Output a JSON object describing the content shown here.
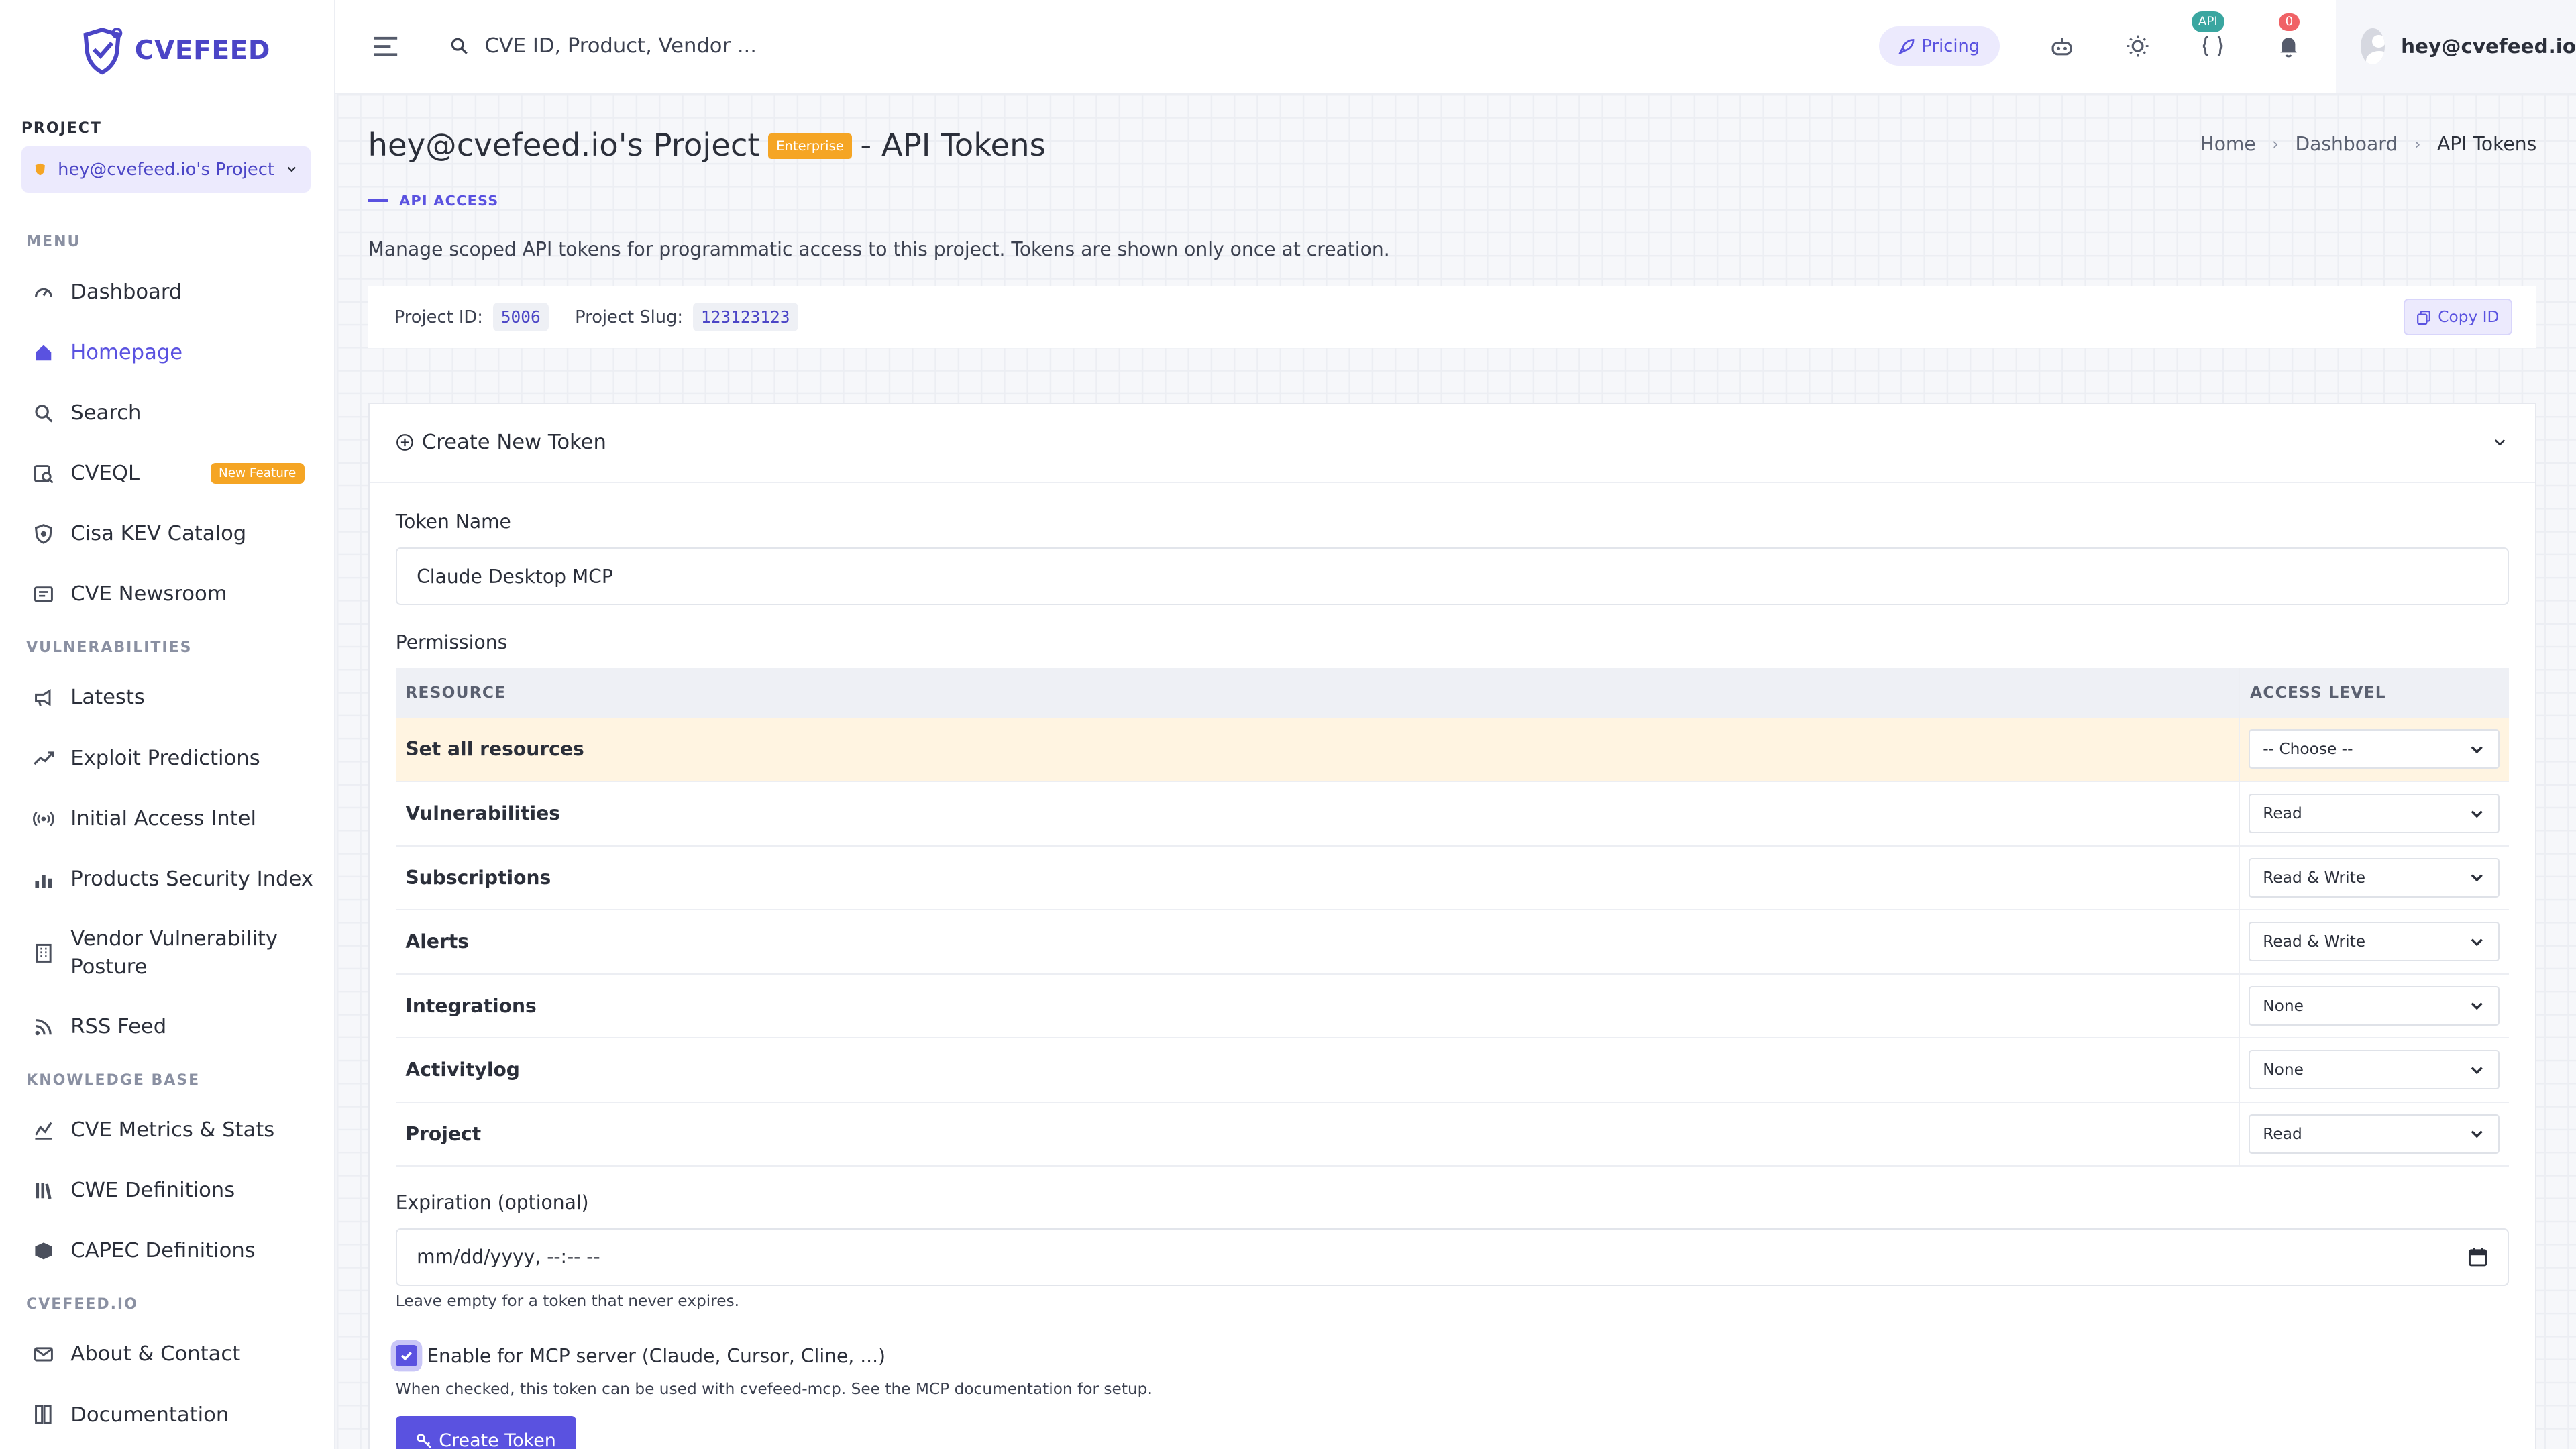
{
  "brand": {
    "name": "CVEFEED",
    "color": "#4b45c6"
  },
  "sidebar": {
    "project_label": "PROJECT",
    "project_name": "hey@cvefeed.io's Project",
    "menu_label": "MENU",
    "menu": [
      {
        "label": "Dashboard",
        "icon": "gauge-icon"
      },
      {
        "label": "Homepage",
        "icon": "home-icon",
        "active": true
      },
      {
        "label": "Search",
        "icon": "search-icon"
      },
      {
        "label": "CVEQL",
        "icon": "query-icon",
        "badge": "New Feature"
      },
      {
        "label": "Cisa KEV Catalog",
        "icon": "shield-icon"
      },
      {
        "label": "CVE Newsroom",
        "icon": "newspaper-icon"
      }
    ],
    "vuln_label": "VULNERABILITIES",
    "vulnerabilities": [
      {
        "label": "Latests",
        "icon": "megaphone-icon"
      },
      {
        "label": "Exploit Predictions",
        "icon": "trend-icon"
      },
      {
        "label": "Initial Access Intel",
        "icon": "broadcast-icon"
      },
      {
        "label": "Products Security Index",
        "icon": "bar-chart-icon"
      },
      {
        "label": "Vendor Vulnerability Posture",
        "icon": "building-icon"
      },
      {
        "label": "RSS Feed",
        "icon": "rss-icon"
      }
    ],
    "kb_label": "KNOWLEDGE BASE",
    "knowledge_base": [
      {
        "label": "CVE Metrics & Stats",
        "icon": "line-chart-icon"
      },
      {
        "label": "CWE Definitions",
        "icon": "library-icon"
      },
      {
        "label": "CAPEC Definitions",
        "icon": "box-icon"
      }
    ],
    "site_label": "CVEFEED.IO",
    "site": [
      {
        "label": "About & Contact",
        "icon": "mail-icon"
      },
      {
        "label": "Documentation",
        "icon": "book-icon"
      }
    ]
  },
  "topbar": {
    "search_placeholder": "CVE ID, Product, Vendor ...",
    "pricing_label": "Pricing",
    "api_badge": "API",
    "notif_count": "0",
    "user_email": "hey@cvefeed.io"
  },
  "page": {
    "title": "hey@cvefeed.io's Project",
    "plan_badge": "Enterprise",
    "title_suffix": "- API Tokens",
    "breadcrumbs": [
      "Home",
      "Dashboard",
      "API Tokens"
    ],
    "section_tag": "API ACCESS",
    "description": "Manage scoped API tokens for programmatic access to this project. Tokens are shown only once at creation.",
    "project_id_label": "Project ID:",
    "project_id": "5006",
    "project_slug_label": "Project Slug:",
    "project_slug": "123123123",
    "copy_label": "Copy ID"
  },
  "form": {
    "card_title": "Create New Token",
    "token_name_label": "Token Name",
    "token_name_value": "Claude Desktop MCP",
    "permissions_label": "Permissions",
    "col_resource": "RESOURCE",
    "col_access": "ACCESS LEVEL",
    "rows": [
      {
        "resource": "Set all resources",
        "access": "-- Choose --"
      },
      {
        "resource": "Vulnerabilities",
        "access": "Read"
      },
      {
        "resource": "Subscriptions",
        "access": "Read & Write"
      },
      {
        "resource": "Alerts",
        "access": "Read & Write"
      },
      {
        "resource": "Integrations",
        "access": "None"
      },
      {
        "resource": "Activitylog",
        "access": "None"
      },
      {
        "resource": "Project",
        "access": "Read"
      }
    ],
    "expiration_label": "Expiration (optional)",
    "expiration_placeholder": "mm/dd/yyyy, --:-- --",
    "expiration_hint": "Leave empty for a token that never expires.",
    "mcp_label": "Enable for MCP server (Claude, Cursor, Cline, ...)",
    "mcp_checked": true,
    "mcp_hint": "When checked, this token can be used with cvefeed-mcp. See the MCP documentation for setup.",
    "submit_label": "Create Token"
  }
}
